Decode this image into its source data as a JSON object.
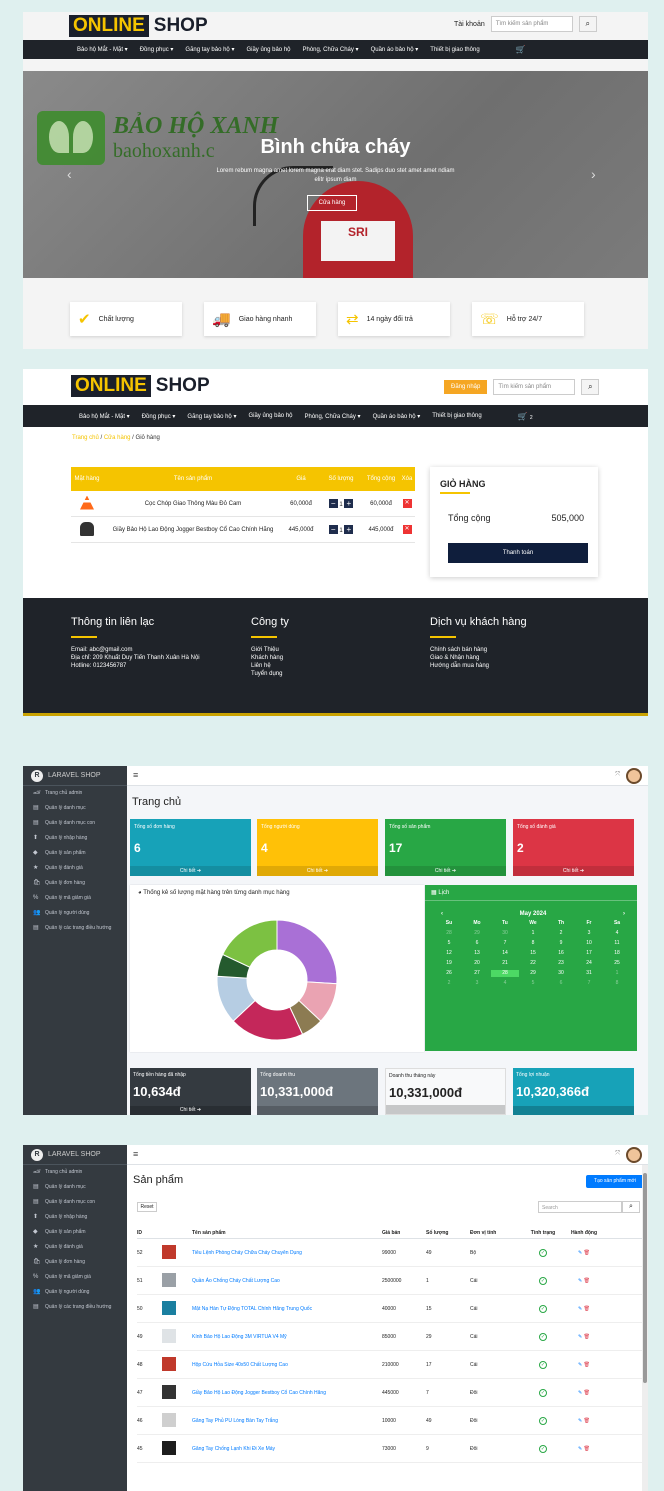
{
  "shop": {
    "logo_a": "ONLINE",
    "logo_b": "SHOP",
    "account": "Tài khoản",
    "login": "Đăng nhập",
    "search_placeholder": "Tìm kiếm sản phẩm",
    "nav": [
      "Bảo hộ Mắt - Mặt ▾",
      "Đồng phục ▾",
      "Găng tay bảo hộ ▾",
      "Giầy ủng bảo hộ",
      "Phòng, Chữa Cháy ▾",
      "Quần áo bảo hộ ▾",
      "Thiết bị giao thông"
    ],
    "cart_count": "2"
  },
  "hero": {
    "brand_name": "BẢO HỘ XANH",
    "brand_site": "baohoxanh.c",
    "title": "Bình chữa cháy",
    "text": "Lorem rebum magna amet lorem magna erat diam stet. Sadips duo stet amet amet ndiam elitr ipsum diam",
    "button": "Cửa hàng",
    "ext_label": "SRI"
  },
  "features": [
    "Chất lượng",
    "Giao hàng nhanh",
    "14 ngày đổi trả",
    "Hỗ trợ 24/7"
  ],
  "cart": {
    "breadcrumb_home": "Trang chủ",
    "breadcrumb_shop": "Cửa hàng",
    "breadcrumb_current": "Giỏ hàng",
    "headers": [
      "Mặt hàng",
      "Tên sản phẩm",
      "Giá",
      "Số lượng",
      "Tổng cộng",
      "Xóa"
    ],
    "rows": [
      {
        "name": "Cọc Chóp Giao Thông Màu Đỏ Cam",
        "price": "60,000đ",
        "qty": "1",
        "total": "60,000đ"
      },
      {
        "name": "Giầy Bảo Hộ Lao Động Jogger Bestboy Cổ Cao Chính Hãng",
        "price": "445,000đ",
        "qty": "1",
        "total": "445,000đ"
      }
    ],
    "box_title": "GIỎ HÀNG",
    "total_label": "Tổng cộng",
    "total_value": "505,000",
    "pay_button": "Thanh toán"
  },
  "footer": {
    "contact_title": "Thông tin liên lạc",
    "contact_lines": [
      "Email: abc@gmail.com",
      "Địa chỉ: 209 Khuất Duy Tiến Thanh Xuân Hà Nội",
      "Hotline: 0123456787"
    ],
    "company_title": "Công ty",
    "company_lines": [
      "Giới Thiệu",
      "Khách hàng",
      "Liên hệ",
      "Tuyển dụng"
    ],
    "service_title": "Dịch vụ khách hàng",
    "service_lines": [
      "Chính sách bán hàng",
      "Giao & Nhận hàng",
      "Hướng dẫn mua hàng"
    ]
  },
  "admin": {
    "brand": "LARAVEL SHOP",
    "sidebar": [
      "Trang chủ admin",
      "Quản lý danh mục",
      "Quản lý danh mục con",
      "Quản lý nhập hàng",
      "Quản lý sản phẩm",
      "Quản lý đánh giá",
      "Quản lý đơn hàng",
      "Quản lý mã giảm giá",
      "Quản lý người dùng",
      "Quản lý các trang điều hướng"
    ],
    "sidebar_icons": [
      "🏎",
      "▤",
      "▤",
      "⬆",
      "◆",
      "★",
      "🛍",
      "%",
      "👥",
      "▤"
    ]
  },
  "dashboard": {
    "title": "Trang chủ",
    "stats": [
      {
        "label": "Tổng số đơn hàng",
        "value": "6",
        "color": "#17a2b8"
      },
      {
        "label": "Tổng người dùng",
        "value": "4",
        "color": "#ffc107"
      },
      {
        "label": "Tổng số sản phẩm",
        "value": "17",
        "color": "#28a745"
      },
      {
        "label": "Tổng số đánh giá",
        "value": "2",
        "color": "#dc3545"
      }
    ],
    "detail": "Chi tiết ➔",
    "chart_title": "Thống kê số lượng mặt hàng trên từng danh mục hàng",
    "calendar_title": "Lịch",
    "calendar_month": "May 2024",
    "weekdays": [
      "Su",
      "Mo",
      "Tu",
      "We",
      "Th",
      "Fr",
      "Sa"
    ],
    "weeks": [
      [
        "28",
        "29",
        "30",
        "1",
        "2",
        "3",
        "4"
      ],
      [
        "5",
        "6",
        "7",
        "8",
        "9",
        "10",
        "11"
      ],
      [
        "12",
        "13",
        "14",
        "15",
        "16",
        "17",
        "18"
      ],
      [
        "19",
        "20",
        "21",
        "22",
        "23",
        "24",
        "25"
      ],
      [
        "26",
        "27",
        "28",
        "29",
        "30",
        "31",
        "1"
      ],
      [
        "2",
        "3",
        "4",
        "5",
        "6",
        "7",
        "8"
      ]
    ],
    "bottom": [
      {
        "label": "Tổng tiền hàng đã nhập",
        "value": "10,634đ",
        "color": "#343a40",
        "footer": "Chi tiết ➔"
      },
      {
        "label": "Tổng doanh thu",
        "value": "10,331,000đ",
        "color": "#6c757d",
        "footer": ""
      },
      {
        "label": "Doanh thu tháng này",
        "value": "10,331,000đ",
        "color": "#f8f9fa",
        "footer": ""
      },
      {
        "label": "Tổng lợi nhuận",
        "value": "10,320,366đ",
        "color": "#17a2b8",
        "footer": ""
      }
    ]
  },
  "chart_data": {
    "type": "pie",
    "values": [
      26,
      11,
      6,
      20,
      13,
      6,
      18
    ],
    "colors": [
      "#a970d6",
      "#eaa3b2",
      "#8c7b52",
      "#c4275a",
      "#b6cde3",
      "#245a2e",
      "#7cc142"
    ]
  },
  "products": {
    "title": "Sản phẩm",
    "new_button": "Tạo sản phẩm mới",
    "reset": "Reset",
    "search_placeholder": "Search",
    "headers": [
      "ID",
      "",
      "Tên sản phẩm",
      "Giá bán",
      "Số lượng",
      "Đơn vị tính",
      "Tình trạng",
      "Hành động"
    ],
    "rows": [
      {
        "id": "52",
        "name": "Tiêu Lệnh Phòng Cháy Chữa Cháy Chuyên Dụng",
        "price": "99000",
        "qty": "49",
        "unit": "Bộ",
        "thumb": "#c0392b"
      },
      {
        "id": "51",
        "name": "Quần Áo Chống Cháy Chất Lượng Cao",
        "price": "2500000",
        "qty": "1",
        "unit": "Cái",
        "thumb": "#9aa0a6"
      },
      {
        "id": "50",
        "name": "Mặt Nạ Hàn Tự Động TOTAL Chính Hãng Trung Quốc",
        "price": "40000",
        "qty": "15",
        "unit": "Cái",
        "thumb": "#1a7fa0"
      },
      {
        "id": "49",
        "name": "Kính Bảo Hộ Lao Động 3M VIRTUA V4 Mỹ",
        "price": "85000",
        "qty": "29",
        "unit": "Cái",
        "thumb": "#dfe3e6"
      },
      {
        "id": "48",
        "name": "Hộp Cứu Hỏa Size 40x50 Chất Lượng Cao",
        "price": "210000",
        "qty": "17",
        "unit": "Cái",
        "thumb": "#c0392b"
      },
      {
        "id": "47",
        "name": "Giầy Bảo Hộ Lao Động Jogger Bestboy Cổ Cao Chính Hãng",
        "price": "445000",
        "qty": "7",
        "unit": "Đôi",
        "thumb": "#333333"
      },
      {
        "id": "46",
        "name": "Găng Tay Phủ PU Lòng Bàn Tay Trắng",
        "price": "10000",
        "qty": "49",
        "unit": "Đôi",
        "thumb": "#cfcfcf"
      },
      {
        "id": "45",
        "name": "Găng Tay Chống Lạnh Khi Đi Xe Máy",
        "price": "73000",
        "qty": "9",
        "unit": "Đôi",
        "thumb": "#1d1d1d"
      }
    ]
  }
}
